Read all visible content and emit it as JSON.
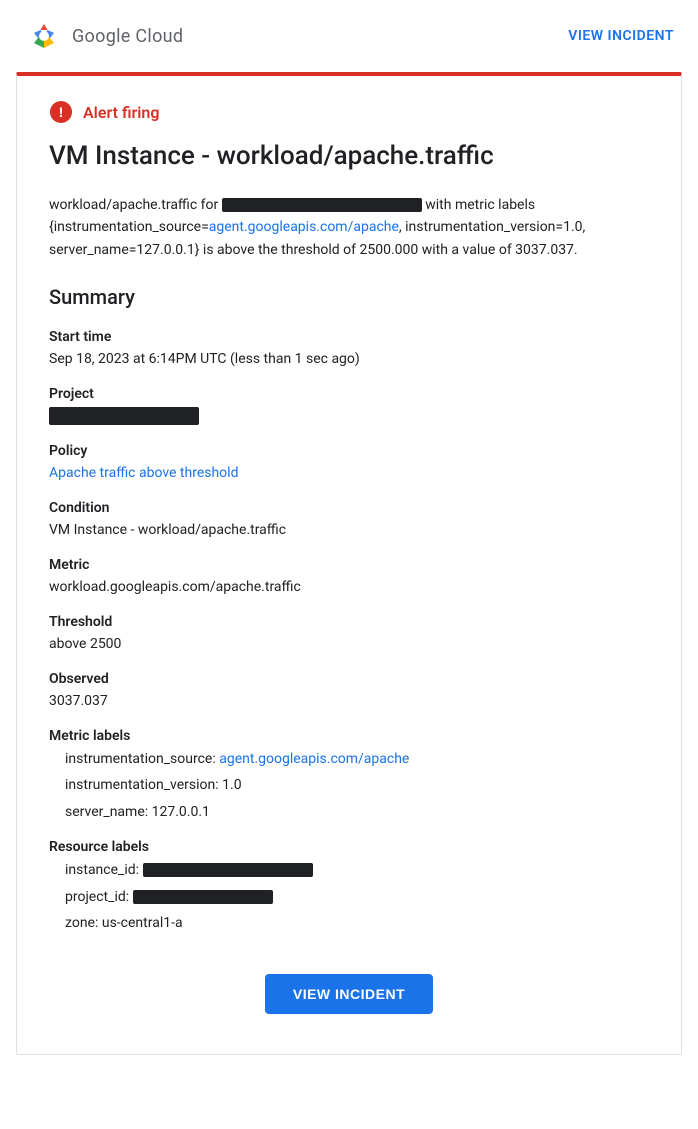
{
  "header": {
    "logo_text": "Google Cloud",
    "view_incident_label": "VIEW INCIDENT"
  },
  "alert": {
    "firing_label": "Alert firing",
    "title": "VM Instance - workload/apache.traffic",
    "description_prefix": "workload/apache.traffic for",
    "description_middle": "with metric labels {instrumentation_source=",
    "agent_link_text": "agent.googleapis.com/apache",
    "agent_link_href": "agent.googleapis.com/apache",
    "description_suffix": ", instrumentation_version=1.0, server_name=127.0.0.1} is above the threshold of 2500.000 with a value of 3037.037."
  },
  "summary": {
    "heading": "Summary",
    "start_time_label": "Start time",
    "start_time_value": "Sep 18, 2023 at 6:14PM UTC (less than 1 sec ago)",
    "project_label": "Project",
    "policy_label": "Policy",
    "policy_link_text": "Apache traffic above threshold",
    "condition_label": "Condition",
    "condition_value": "VM Instance - workload/apache.traffic",
    "metric_label": "Metric",
    "metric_value": "workload.googleapis.com/apache.traffic",
    "threshold_label": "Threshold",
    "threshold_value": "above 2500",
    "observed_label": "Observed",
    "observed_value": "3037.037",
    "metric_labels_label": "Metric labels",
    "metric_labels": {
      "instrumentation_source_label": "instrumentation_source:",
      "instrumentation_source_link_text": "agent.googleapis.com/apache",
      "instrumentation_source_link_href": "agent.googleapis.com/apache",
      "instrumentation_version_label": "instrumentation_version:",
      "instrumentation_version_value": "1.0",
      "server_name_label": "server_name:",
      "server_name_value": "127.0.0.1"
    },
    "resource_labels_label": "Resource labels",
    "resource_labels": {
      "instance_id_label": "instance_id:",
      "project_id_label": "project_id:",
      "zone_label": "zone:",
      "zone_value": "us-central1-a"
    }
  },
  "footer": {
    "view_incident_btn_label": "VIEW INCIDENT"
  }
}
